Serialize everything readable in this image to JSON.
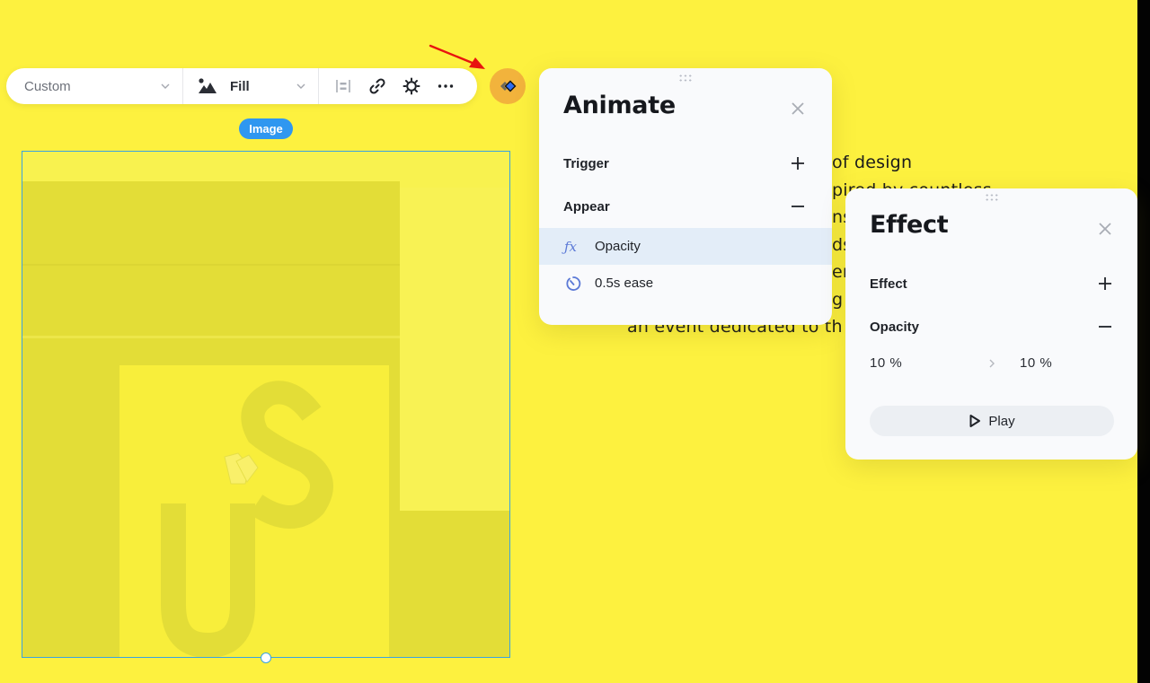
{
  "toolbar": {
    "size_select": {
      "value": "Custom"
    },
    "fit_select": {
      "value": "Fill",
      "icon": "image-icon"
    },
    "icons": [
      "align-icon",
      "link-icon",
      "settings-icon",
      "more-icon"
    ],
    "animate_button_icon": "animate-icon"
  },
  "element_badge": "Image",
  "background_text": {
    "lines": [
      "of design",
      "pired by countless",
      "ns",
      "ds",
      "ere",
      "g",
      "an event dedicated to th"
    ]
  },
  "animate_panel": {
    "title": "Animate",
    "sections": [
      {
        "label": "Trigger",
        "action": "plus-icon"
      },
      {
        "label": "Appear",
        "action": "minus-icon"
      }
    ],
    "items": [
      {
        "icon": "fx-icon",
        "label": "Opacity",
        "selected": true
      },
      {
        "icon": "timer-icon",
        "label": "0.5s ease",
        "selected": false
      }
    ]
  },
  "effect_panel": {
    "title": "Effect",
    "sections": [
      {
        "label": "Effect",
        "action": "plus-icon"
      },
      {
        "label": "Opacity",
        "action": "minus-icon"
      }
    ],
    "opacity_from": "10 %",
    "opacity_to": "10 %",
    "play_label": "Play"
  },
  "colors": {
    "canvas_background": "#fdf13f",
    "selection_blue": "#3aa3e0",
    "badge_blue": "#2f97f0",
    "animate_button": "#f2b33c",
    "selected_row": "#e3edf8",
    "annotation_arrow": "#e8140f"
  }
}
